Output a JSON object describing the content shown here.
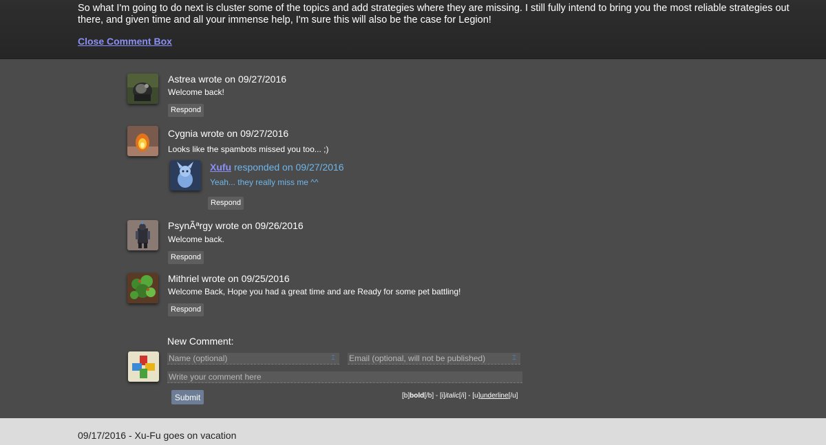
{
  "post": {
    "body_text": "So what I'm going to do next is cluster some of the topics and add strategies where they are missing. I still fully intend to bring you the most reliable strategies out there, and given time and all your immense help, I'm sure this will also be the case for Legion!",
    "close_label": "Close Comment Box"
  },
  "comments": [
    {
      "author": "Astrea",
      "wrote_on": "wrote on 09/27/2016",
      "text": "Welcome back!",
      "respond_label": "Respond"
    },
    {
      "author": "Cygnia",
      "wrote_on": "wrote on 09/27/2016",
      "text": "Looks like the spambots missed you too... ;)",
      "respond_label": "Respond",
      "reply": {
        "author": "Xufu",
        "responded_on": "responded on 09/27/2016",
        "text": "Yeah... they really miss me ^^"
      }
    },
    {
      "author": "PsynÃªrgy",
      "wrote_on": "wrote on 09/26/2016",
      "text": "Welcome back.",
      "respond_label": "Respond"
    },
    {
      "author": "Mithriel",
      "wrote_on": "wrote on 09/25/2016",
      "text": "Welcome Back, Hope you had a great time and are Ready for some pet battling!",
      "respond_label": "Respond"
    }
  ],
  "new_comment": {
    "title": "New Comment:",
    "name_placeholder": "Name (optional)",
    "email_placeholder": "Email (optional, will not be published)",
    "comment_placeholder": "Write your comment here",
    "submit_label": "Submit",
    "bb_bold_open": "[b]",
    "bb_bold": "bold",
    "bb_bold_close": "[/b]",
    "bb_sep1": " - ",
    "bb_italic_open": "[i]",
    "bb_italic": "italic",
    "bb_italic_close": "[/i]",
    "bb_sep2": " - ",
    "bb_underline_open": "[u]",
    "bb_underline": "underline",
    "bb_underline_close": "[/u]"
  },
  "next_post": {
    "title": "09/17/2016 - Xu-Fu goes on vacation"
  },
  "colors": {
    "background": "#4b4b4b",
    "link": "#8a8ff5",
    "reply_text": "#6fb6ea",
    "respond_button": "#5e5e5e",
    "submit_button": "#6d7d95"
  },
  "icons": {
    "field_icon": "input-helper-icon"
  }
}
